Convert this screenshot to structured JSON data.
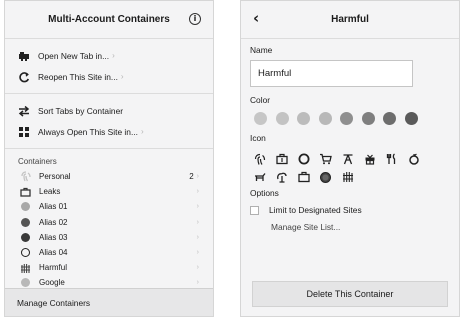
{
  "left": {
    "title": "Multi-Account Containers",
    "info_icon": "info-icon",
    "info_glyph": "i",
    "menu": [
      {
        "label": "Open New Tab in...",
        "icon": "new-tab-icon"
      },
      {
        "label": "Reopen This Site in...",
        "icon": "reopen-icon"
      },
      {
        "label": "Sort Tabs by Container",
        "icon": "sort-icon"
      },
      {
        "label": "Always Open This Site in...",
        "icon": "always-open-icon"
      }
    ],
    "containers_label": "Containers",
    "containers": [
      {
        "name": "Personal",
        "count": "2",
        "icon": "personal-fingerprint-icon",
        "color": "#bdbdbd"
      },
      {
        "name": "Leaks",
        "count": "",
        "icon": "leaks-briefcase-icon",
        "color": "#333333"
      },
      {
        "name": "Alias 01",
        "count": "",
        "icon": "circle-icon",
        "color": "#a8a8a8"
      },
      {
        "name": "Alias 02",
        "count": "",
        "icon": "circle-icon",
        "color": "#555555"
      },
      {
        "name": "Alias 03",
        "count": "",
        "icon": "circle-icon",
        "color": "#3a3a3a"
      },
      {
        "name": "Alias 04",
        "count": "",
        "icon": "circle-outline-icon",
        "color": "#222222"
      },
      {
        "name": "Harmful",
        "count": "",
        "icon": "fence-icon",
        "color": "#444444"
      },
      {
        "name": "Google",
        "count": "",
        "icon": "circle-icon",
        "color": "#b8b8b8"
      }
    ],
    "manage_label": "Manage Containers"
  },
  "right": {
    "title": "Harmful",
    "back_glyph": "‹",
    "name_label": "Name",
    "name_value": "Harmful",
    "color_label": "Color",
    "colors": [
      "#c6c6c6",
      "#c3c3c3",
      "#bcbcbc",
      "#b8b8b8",
      "#8f8f8f",
      "#7f7f7f",
      "#6d6d6d",
      "#5a5a5a"
    ],
    "icon_label": "Icon",
    "icons_row1": [
      "fingerprint-icon",
      "briefcase-icon",
      "dollar-icon",
      "cart-icon",
      "vacation-icon",
      "gift-icon",
      "food-icon",
      "fruit-icon"
    ],
    "icons_row2": [
      "pet-icon",
      "tree-icon",
      "chill-icon",
      "circle-icon",
      "fence-icon"
    ],
    "options_label": "Options",
    "limit_label": "Limit to Designated Sites",
    "manage_sites_label": "Manage Site List...",
    "delete_label": "Delete This Container"
  }
}
